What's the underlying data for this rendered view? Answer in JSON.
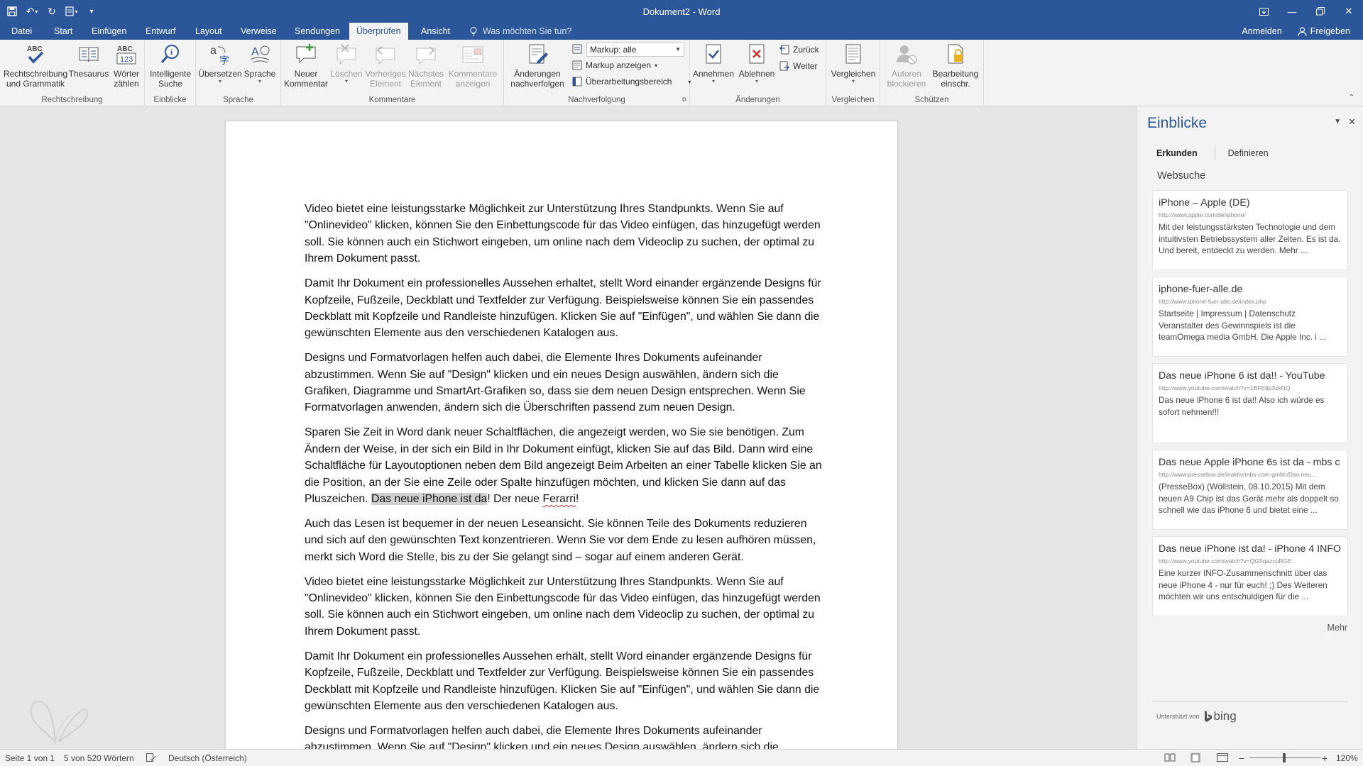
{
  "window": {
    "title": "Dokument2 - Word"
  },
  "tabs": [
    {
      "label": "Datei"
    },
    {
      "label": "Start"
    },
    {
      "label": "Einfügen"
    },
    {
      "label": "Entwurf"
    },
    {
      "label": "Layout"
    },
    {
      "label": "Verweise"
    },
    {
      "label": "Sendungen"
    },
    {
      "label": "Überprüfen"
    },
    {
      "label": "Ansicht"
    }
  ],
  "tellme": {
    "placeholder": "Was möchten Sie tun?"
  },
  "account": {
    "signin": "Anmelden",
    "share": "Freigeben"
  },
  "ribbon": {
    "groups": {
      "rechtschreibung": "Rechtschreibung",
      "einblicke": "Einblicke",
      "sprache": "Sprache",
      "kommentare": "Kommentare",
      "nachverfolgung": "Nachverfolgung",
      "aenderungen": "Änderungen",
      "vergleichen": "Vergleichen",
      "schuetzen": "Schützen"
    },
    "buttons": {
      "spelling": [
        "Rechtschreibung",
        "und Grammatik"
      ],
      "thesaurus": [
        "Thesaurus"
      ],
      "wordcount": [
        "Wörter",
        "zählen"
      ],
      "smartlookup": [
        "Intelligente",
        "Suche"
      ],
      "translate": [
        "Übersetzen"
      ],
      "language": [
        "Sprache"
      ],
      "newcomment": [
        "Neuer",
        "Kommentar"
      ],
      "delete": [
        "Löschen"
      ],
      "previous": [
        "Vorheriges",
        "Element"
      ],
      "next": [
        "Nächstes",
        "Element"
      ],
      "showcomments": [
        "Kommentare",
        "anzeigen"
      ],
      "trackchanges": [
        "Änderungen",
        "nachverfolgen"
      ],
      "accept": [
        "Annehmen"
      ],
      "reject": [
        "Ablehnen"
      ],
      "compare": [
        "Vergleichen"
      ],
      "blockauthors": [
        "Autoren",
        "blockieren"
      ],
      "restrict": [
        "Bearbeitung",
        "einschr."
      ]
    },
    "small": {
      "markup_value": "Markup: alle",
      "show_markup": "Markup anzeigen",
      "review_pane": "Überarbeitungsbereich",
      "back": "Zurück",
      "forward": "Weiter"
    }
  },
  "document": {
    "paragraphs": [
      "Video bietet eine leistungsstarke Möglichkeit zur Unterstützung Ihres Standpunkts. Wenn Sie auf \"Onlinevideo\" klicken, können Sie den Einbettungscode für das Video einfügen, das hinzugefügt werden soll. Sie können auch ein Stichwort eingeben, um online nach dem Videoclip zu suchen, der optimal zu Ihrem Dokument passt.",
      "Damit Ihr Dokument ein professionelles Aussehen erhaltet, stellt Word einander ergänzende Designs für Kopfzeile, Fußzeile, Deckblatt und Textfelder zur Verfügung. Beispielsweise können Sie ein passendes Deckblatt mit Kopfzeile und Randleiste hinzufügen. Klicken Sie auf \"Einfügen\", und wählen Sie dann die gewünschten Elemente aus den verschiedenen Katalogen aus.",
      "Designs und Formatvorlagen helfen auch dabei, die Elemente Ihres Dokuments aufeinander abzustimmen. Wenn Sie auf \"Design\" klicken und ein neues Design auswählen, ändern sich die Grafiken, Diagramme und SmartArt-Grafiken so, dass sie dem neuen Design entsprechen. Wenn Sie Formatvorlagen anwenden, ändern sich die Überschriften passend zum neuen Design."
    ],
    "p4_start": "Sparen Sie Zeit in Word dank neuer Schaltflächen, die angezeigt werden, wo Sie sie benötigen. Zum Ändern der Weise, in der sich ein Bild in Ihr Dokument einfügt, klicken Sie auf das Bild. Dann wird eine Schaltfläche für Layoutoptionen neben dem Bild angezeigt Beim Arbeiten an einer Tabelle klicken Sie an die Position, an der Sie eine Zeile oder Spalte hinzufügen möchten, und klicken Sie dann auf das Pluszeichen. ",
    "p4_selected": "Das neue iPhone ist da",
    "p4_mid": "! Der neue ",
    "p4_misspelled": "Ferarri",
    "p4_end": "!",
    "paragraphs2": [
      "Auch das Lesen ist bequemer in der neuen Leseansicht. Sie können Teile des Dokuments reduzieren und sich auf den gewünschten Text konzentrieren. Wenn Sie vor dem Ende zu lesen aufhören müssen, merkt sich Word die Stelle, bis zu der Sie gelangt sind – sogar auf einem anderen Gerät.",
      "Video bietet eine leistungsstarke Möglichkeit zur Unterstützung Ihres Standpunkts. Wenn Sie auf \"Onlinevideo\" klicken, können Sie den Einbettungscode für das Video einfügen, das hinzugefügt werden soll. Sie können auch ein Stichwort eingeben, um online nach dem Videoclip zu suchen, der optimal zu Ihrem Dokument passt.",
      "Damit Ihr Dokument ein professionelles Aussehen erhält, stellt Word einander ergänzende Designs für Kopfzeile, Fußzeile, Deckblatt und Textfelder zur Verfügung. Beispielsweise können Sie ein passendes Deckblatt mit Kopfzeile und Randleiste hinzufügen. Klicken Sie auf \"Einfügen\", und wählen Sie dann die gewünschten Elemente aus den verschiedenen Katalogen aus.",
      "Designs und Formatvorlagen helfen auch dabei, die Elemente Ihres Dokuments aufeinander abzustimmen. Wenn Sie auf \"Design\" klicken und ein neues Design auswählen, ändern sich die"
    ]
  },
  "insights": {
    "title": "Einblicke",
    "tabs": {
      "explore": "Erkunden",
      "define": "Definieren"
    },
    "section": "Websuche",
    "results": [
      {
        "title": "iPhone – Apple (DE)",
        "url": "http://www.apple.com/de/iphone/",
        "snippet": "Mit der leistungsstärksten Technologie und dem intuitivsten Betriebssystem aller Zeiten. Es ist da. Und bereit, entdeckt zu werden. Mehr ..."
      },
      {
        "title": "iphone-fuer-alle.de",
        "url": "http://www.iphone-fuer-alle.de/index.php",
        "snippet": "Startseite | Impressum | Datenschutz Veranstalter des Gewinnspiels ist die teamOmega media GmbH. Die Apple Inc. i ..."
      },
      {
        "title": "Das neue iPhone 6 ist da!! - YouTube",
        "url": "http://www.youtube.com/watch?v=1BFE8p3zkNQ",
        "snippet": "Das neue iPhone 6 ist da!! Also ich würde es sofort nehmen!!!"
      },
      {
        "title": "Das neue Apple iPhone 6s ist da - mbs c",
        "url": "http://www.pressebox.de/inaktiv/mbs-com-gmbh/Das-neu...",
        "snippet": "(PresseBox) (Wöllstein, 08.10.2015) Mit dem neuen A9 Chip ist das Gerät mehr als doppelt so schnell wie das iPhone 6 und bietet eine ..."
      },
      {
        "title": "Das neue iPhone ist da! - iPhone 4 INFO",
        "url": "http://www.youtube.com/watch?v=QG5qazcpRGE",
        "snippet": "Eine kurzer INFO-Zusammenschnitt über das neue iPhone 4 - nur für euch! ;) Des Weiteren möchten wir uns entschuldigen für die ..."
      }
    ],
    "more": "Mehr",
    "powered_by": "Unterstützt von",
    "bing": "bing"
  },
  "status": {
    "page": "Seite 1 von 1",
    "words": "5 von 520 Wörtern",
    "language": "Deutsch (Österreich)",
    "zoom": "120%"
  },
  "colors": {
    "accent": "#2b579a",
    "ribbon_bg": "#f3f3f3",
    "doc_bg": "#e6e6e6"
  }
}
